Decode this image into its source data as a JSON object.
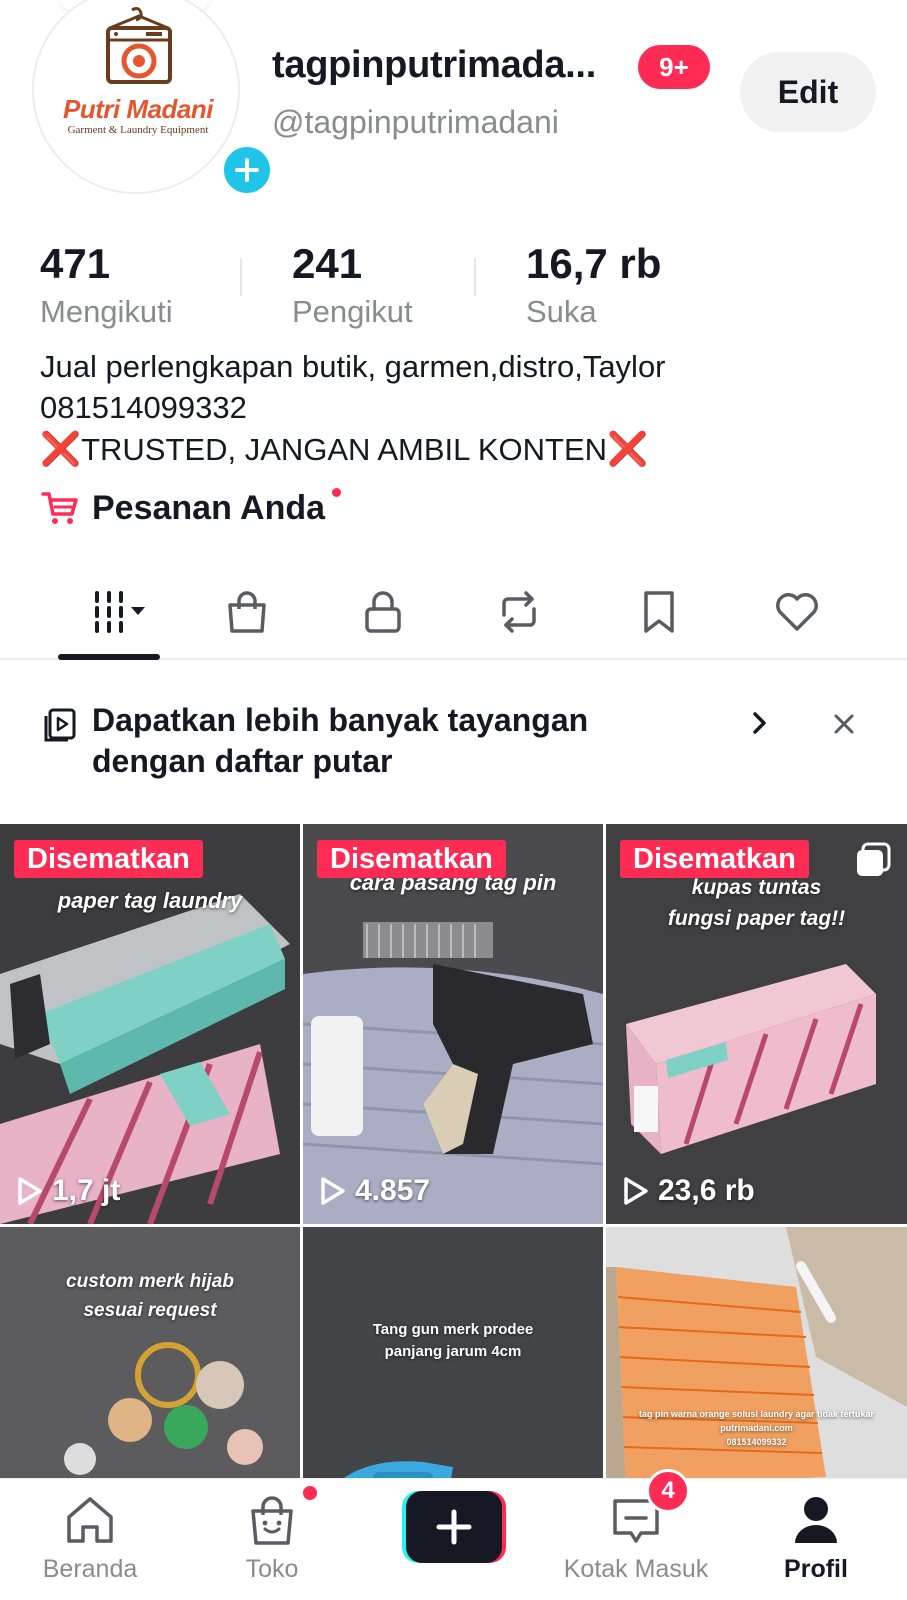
{
  "profile": {
    "brand_name": "Putri Madani",
    "brand_subtitle": "Garment & Laundry Equipment",
    "username": "tagpinputrimada...",
    "notification_count": "9+",
    "handle": "@tagpinputrimadani",
    "edit_label": "Edit"
  },
  "stats": [
    {
      "value": "471",
      "label": "Mengikuti"
    },
    {
      "value": "241",
      "label": "Pengikut"
    },
    {
      "value": "16,7 rb",
      "label": "Suka"
    }
  ],
  "bio": {
    "line1": "Jual perlengkapan butik, garmen,distro,Taylor",
    "line2": "081514099332",
    "line3": "TRUSTED, JANGAN AMBIL KONTEN",
    "x_mark": "❌"
  },
  "orders": {
    "label": "Pesanan Anda"
  },
  "tabs": [
    "videos-icon",
    "shop-icon",
    "private-lock-icon",
    "repost-icon",
    "bookmark-icon",
    "liked-heart-icon"
  ],
  "banner": {
    "text": "Dapatkan lebih banyak tayangan dengan daftar putar"
  },
  "videos": [
    {
      "pinned": "Disematkan",
      "caption": "paper tag laundry",
      "views": "1,7 jt"
    },
    {
      "pinned": "Disematkan",
      "caption": "cara pasang tag pin",
      "views": "4.857"
    },
    {
      "pinned": "Disematkan",
      "caption": "kupas tuntas fungsi paper tag!!",
      "caption_line1": "kupas tuntas",
      "caption_line2": "fungsi paper tag!!",
      "views": "23,6 rb"
    },
    {
      "caption_line1": "custom merk hijab",
      "caption_line2": "sesuai request"
    },
    {
      "caption_line1": "Tang gun merk prodee",
      "caption_line2": "panjang jarum 4cm"
    },
    {
      "caption_line1": "tag pin warna orange solusi laundry agar tidak tertukar",
      "caption_line2": "putrimadani.com",
      "caption_line3": "081514099332"
    }
  ],
  "bottom_nav": {
    "home": "Beranda",
    "shop": "Toko",
    "inbox": "Kotak Masuk",
    "inbox_count": "4",
    "profile": "Profil"
  },
  "colors": {
    "accent": "#fe2c55",
    "cyan": "#25f4ee",
    "badge_blue": "#20c4e8",
    "brand_orange": "#e4572e"
  }
}
